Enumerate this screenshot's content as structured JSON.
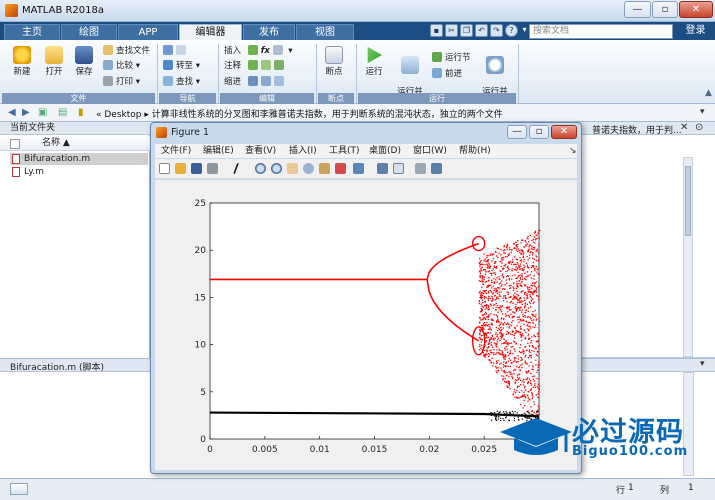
{
  "window": {
    "title": "MATLAB R2018a",
    "controls": [
      "—",
      "▫",
      "✕"
    ]
  },
  "tabs": [
    {
      "label": "主页"
    },
    {
      "label": "绘图"
    },
    {
      "label": "APP"
    },
    {
      "label": "编辑器"
    },
    {
      "label": "发布"
    },
    {
      "label": "视图"
    }
  ],
  "active_tab": "编辑器",
  "search": {
    "placeholder": "搜索文档"
  },
  "login_label": "登录",
  "ribbon": {
    "file_group": {
      "label": "文件",
      "new_label": "新建",
      "open_label": "打开",
      "save_label": "保存",
      "find_files_label": "查找文件",
      "compare_label": "比较",
      "print_label": "打印"
    },
    "nav_group": {
      "label": "导航",
      "goto_label": "转至",
      "find_label": "查找"
    },
    "edit_group": {
      "label": "编辑",
      "insert_label": "插入",
      "comment_label": "注释",
      "indent_label": "缩进",
      "fx_label": "fx"
    },
    "breakpoint_group": {
      "label": "断点",
      "breakpoints_label": "断点"
    },
    "run_group": {
      "label": "运行",
      "run_label": "运行",
      "run_advance_label": "运行并\n前进",
      "run_section_label": "运行节",
      "advance_label": "前进",
      "run_time_label": "运行并\n计时"
    }
  },
  "address": {
    "path": "«  Desktop  ▸ 计算非线性系统的分叉图和李雅普诺夫指数，用于判断系统的混沌状态，独立的两个文件"
  },
  "current_folder": {
    "title": "当前文件夹",
    "column_name": "名称 ▲",
    "files": [
      {
        "name": "Bifuracation.m",
        "selected": true
      },
      {
        "name": "Ly.m",
        "selected": false
      }
    ]
  },
  "command_panel": {
    "visible_text": "普诺夫指数，用于判..."
  },
  "details": {
    "label": "Bifuracation.m  (脚本)"
  },
  "status": {
    "row_label": "行",
    "row_value": "1",
    "col_label": "列",
    "col_value": "1"
  },
  "figure": {
    "title": "Figure 1",
    "menu": [
      "文件(F)",
      "编辑(E)",
      "查看(V)",
      "插入(I)",
      "工具(T)",
      "桌面(D)",
      "窗口(W)",
      "帮助(H)"
    ]
  },
  "chart_data": {
    "type": "scatter",
    "title": "",
    "xlabel": "",
    "ylabel": "",
    "xlim": [
      0,
      0.03
    ],
    "ylim": [
      0,
      25
    ],
    "xticks": [
      "0",
      "0.005",
      "0.01",
      "0.015",
      "0.02",
      "0.025"
    ],
    "yticks": [
      "0",
      "5",
      "10",
      "15",
      "20",
      "25"
    ],
    "grid": false,
    "series": [
      {
        "color": "#ff0000",
        "segments": [
          {
            "kind": "fixed",
            "x": [
              0,
              0.0198
            ],
            "y": 16.9
          },
          {
            "kind": "branch_upper",
            "x": [
              0.0198,
              0.0245
            ],
            "y": [
              16.9,
              20.7
            ]
          },
          {
            "kind": "branch_lower",
            "x": [
              0.0198,
              0.0245
            ],
            "y": [
              16.9,
              10.4
            ]
          },
          {
            "kind": "chaos",
            "x": [
              0.0245,
              0.03
            ],
            "y": [
              0.5,
              22.3
            ]
          }
        ]
      },
      {
        "color": "#000000",
        "segments": [
          {
            "kind": "fixed",
            "x": [
              0,
              0.03
            ],
            "y": [
              2.8,
              2.4
            ]
          }
        ]
      }
    ]
  },
  "watermark": {
    "title": "必过源码",
    "subtitle": "Biguo100.com"
  },
  "colors": {
    "tab_bar": "#1c4e84",
    "ribbon_group": "#7d98ba",
    "plot_red": "#ff0000",
    "watermark_blue": "#0a69b5"
  }
}
